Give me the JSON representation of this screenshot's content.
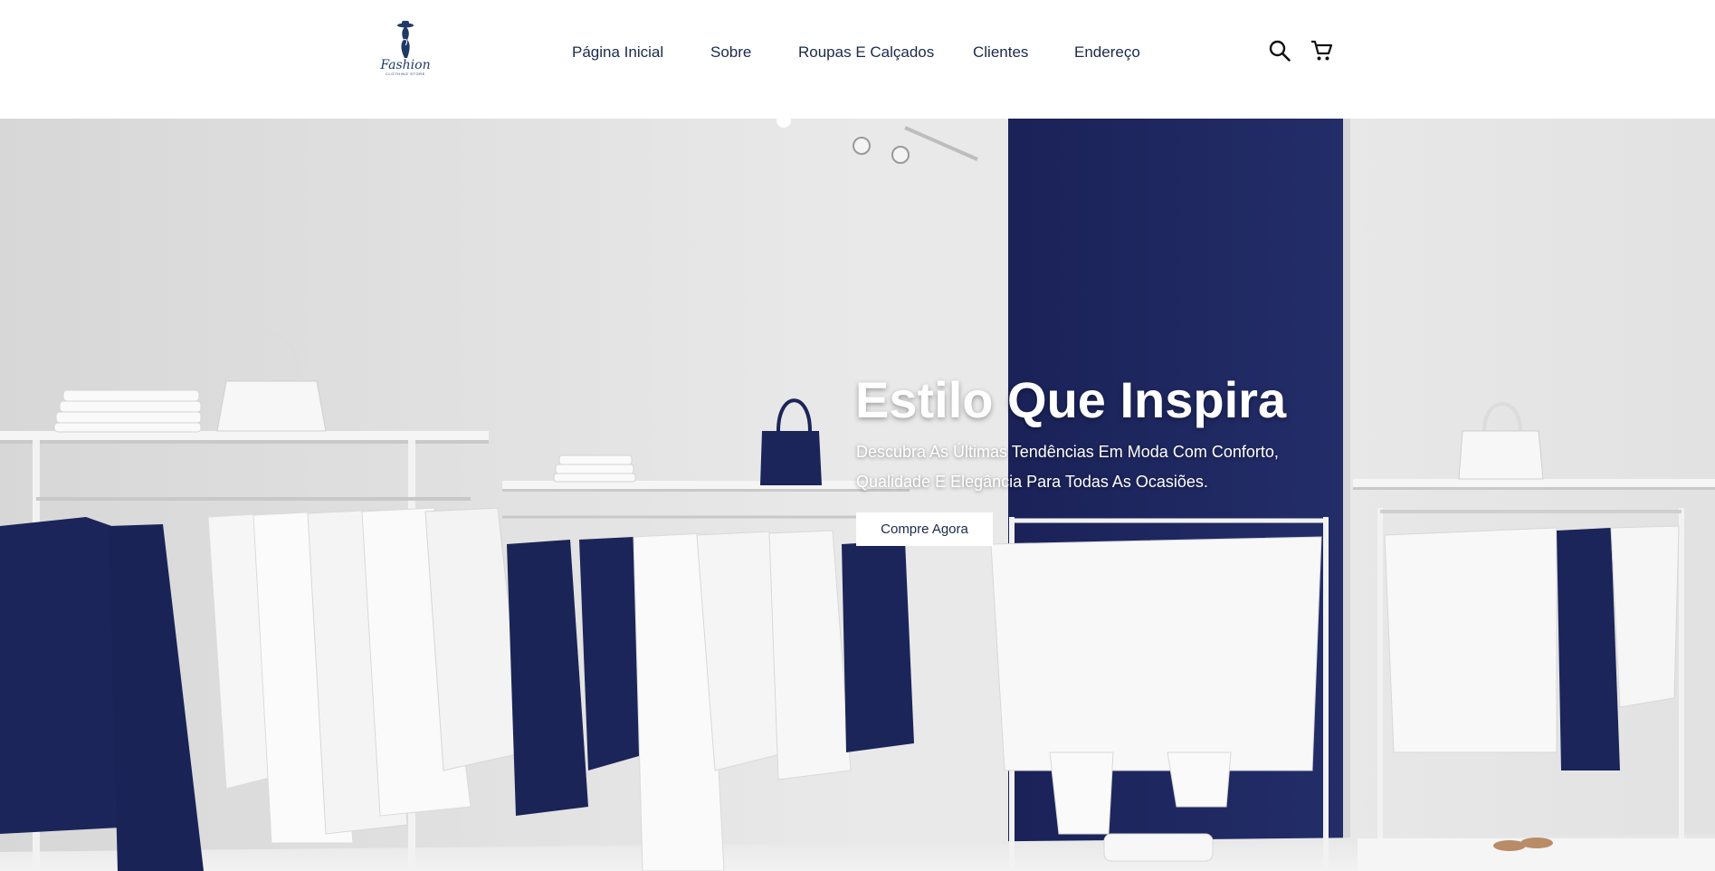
{
  "brand": {
    "logo_word": "Fashion",
    "logo_subtitle": "CLOTHING STORE"
  },
  "nav": {
    "items": [
      {
        "label": "Página Inicial"
      },
      {
        "label": "Sobre"
      },
      {
        "label": "Roupas E Calçados"
      },
      {
        "label": "Clientes"
      },
      {
        "label": "Endereço"
      }
    ]
  },
  "icons": {
    "search": "search-icon",
    "cart": "cart-icon"
  },
  "hero": {
    "title": "Estilo Que Inspira",
    "description": "Descubra As Últimas Tendências Em Moda Com Conforto, Qualidade E Elegância Para Todas As Ocasiões.",
    "cta_label": "Compre Agora"
  },
  "colors": {
    "navy": "#1c2559",
    "text": "#1b2a4a",
    "wall": "#e4e4e4",
    "white": "#ffffff"
  }
}
